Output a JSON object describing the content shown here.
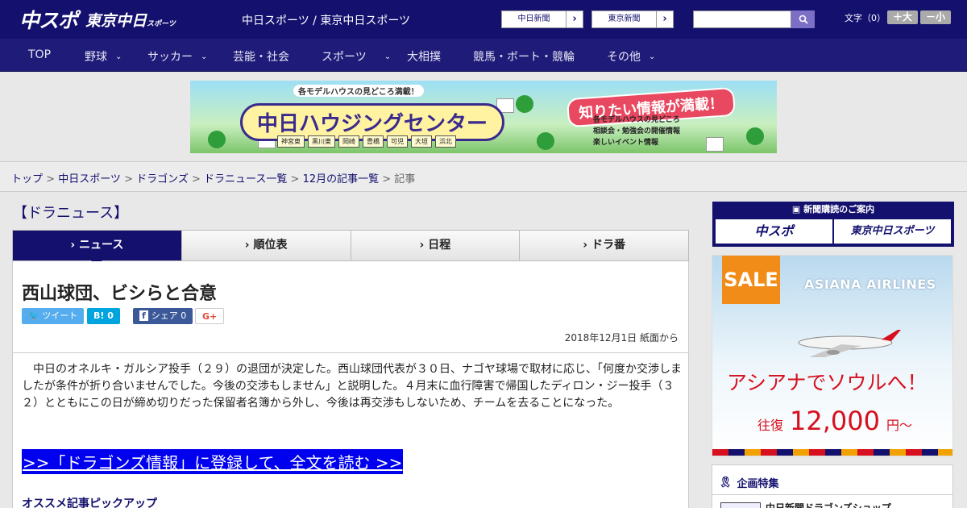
{
  "header": {
    "logo_main": "中スポ",
    "logo_sub": "東京中日",
    "logo_sub_small": "スポーツ",
    "site_name": "中日スポーツ / 東京中日スポーツ",
    "btn_chunichi": "中日新聞",
    "btn_tokyo": "東京新聞",
    "font_label": "文字（0）",
    "font_larger": "＋大",
    "font_smaller": "－小"
  },
  "nav": [
    {
      "label": "TOP",
      "chevron": ""
    },
    {
      "label": "野球",
      "chevron": "⌄"
    },
    {
      "label": "サッカー",
      "chevron": "⌄"
    },
    {
      "label": "芸能・社会",
      "chevron": ""
    },
    {
      "label": "スポーツ",
      "chevron": "⌄"
    },
    {
      "label": "大相撲",
      "chevron": ""
    },
    {
      "label": "競馬・ボート・競輪",
      "chevron": ""
    },
    {
      "label": "その他",
      "chevron": "⌄"
    }
  ],
  "banner": {
    "top_text": "各モデルハウスの見どころ満載！",
    "title": "中日ハウジングセンター",
    "badge": "知りたい情報が満載！",
    "list": [
      "各モデルハウスの見どころ",
      "相談会・勉強会の開催情報",
      "楽しいイベント情報"
    ],
    "cities": [
      "神宮東",
      "黒川東",
      "岡崎",
      "豊橋",
      "可児",
      "大垣",
      "浜北"
    ]
  },
  "breadcrumb": {
    "items": [
      "トップ",
      "中日スポーツ",
      "ドラゴンズ",
      "ドラニュース一覧",
      "12月の記事一覧"
    ],
    "current": "記事",
    "sep": " > "
  },
  "main": {
    "section_label": "【ドラニュース】",
    "tabs": [
      "ニュース",
      "順位表",
      "日程",
      "ドラ番"
    ],
    "article": {
      "title": "西山球団、ビシらと合意",
      "share": {
        "tweet": "ツイート",
        "hatena": "B! 0",
        "facebook": "シェア 0",
        "gplus": "G+"
      },
      "date": "2018年12月1日 紙面から",
      "body": "　中日のオネルキ・ガルシア投手（２９）の退団が決定した。西山球団代表が３０日、ナゴヤ球場で取材に応じ、「何度か交渉しましたが条件が折り合いませんでした。今後の交渉もしません」と説明した。４月末に血行障害で帰国したディロン・ジー投手（３２）とともにこの日が締め切りだった保留者名簿から外し、今後は再交渉もしないため、チームを去ることになった。",
      "cta": ">>「ドラゴンズ情報」に登録して、全文を読む >>",
      "pickup": "オススメ記事ピックアップ"
    }
  },
  "sidebar": {
    "subscribe_head": "新聞購読のご案内",
    "sub_btn1": "中スポ",
    "sub_btn2": "東京中日スポーツ",
    "ad": {
      "sale": "SALE",
      "brand": "ASIANA AIRLINES",
      "line1": "アシアナでソウルへ！",
      "line2a": "往復",
      "line2b": "12,000",
      "line2c": "円〜"
    },
    "feature_head": "企画特集",
    "feature_item": "中日新聞ドラゴンズショップ"
  },
  "colors": {
    "navy": "#13106e",
    "nav": "#1f1b78",
    "cta_bg": "#0000ee",
    "ad_red": "#d6101e"
  }
}
